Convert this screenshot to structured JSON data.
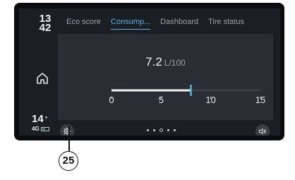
{
  "status": {
    "time_hour": "13",
    "time_minute": "42",
    "temperature": "14",
    "temperature_unit": "°",
    "network": "4G",
    "battery_level": 0.6
  },
  "tabs": [
    {
      "label": "Eco score",
      "active": false
    },
    {
      "label": "Consump...",
      "active": true
    },
    {
      "label": "Dashboard",
      "active": false
    },
    {
      "label": "Tire status",
      "active": false
    }
  ],
  "consumption": {
    "value": "7.2",
    "unit": "L/100",
    "gauge_min": 0,
    "gauge_max": 15,
    "current_value": 8.0,
    "ticks": [
      "0",
      "5",
      "10",
      "15"
    ]
  },
  "pager": {
    "count": 5,
    "active_index": 2
  },
  "icons": {
    "home": "home-icon",
    "settings": "gear-icon",
    "sound": "speaker-icon"
  },
  "colors": {
    "accent": "#4fb6e4",
    "background": "#1b1e22",
    "panel": "#2a2e34",
    "battery": "#3ec45e"
  },
  "callout": {
    "label": "25"
  }
}
